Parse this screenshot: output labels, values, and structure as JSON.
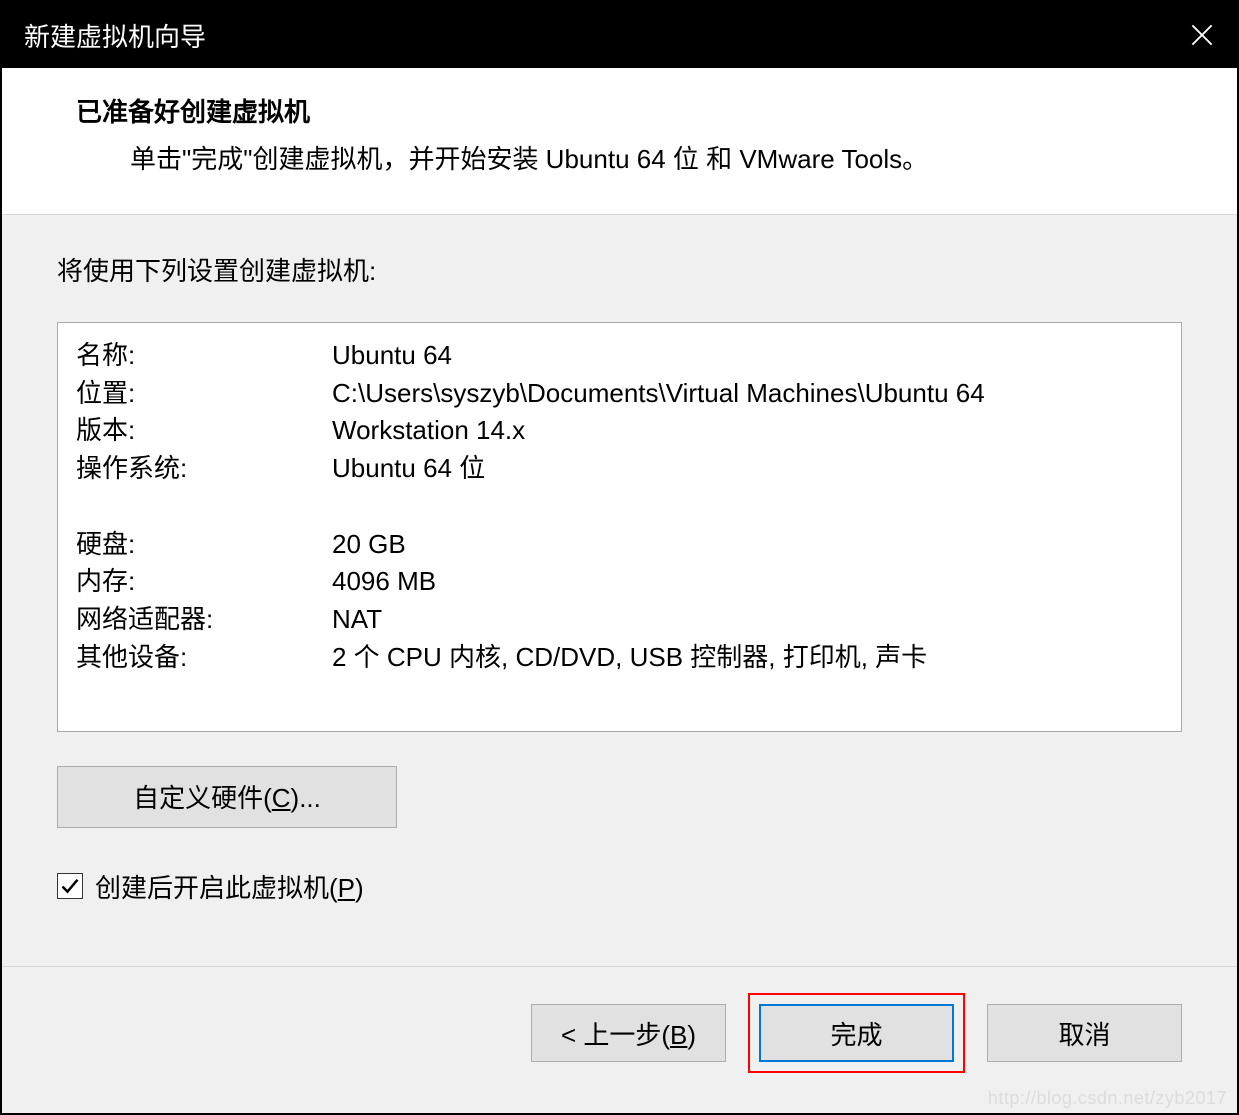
{
  "titlebar": {
    "title": "新建虚拟机向导"
  },
  "header": {
    "title": "已准备好创建虚拟机",
    "subtitle": "单击\"完成\"创建虚拟机，并开始安装 Ubuntu 64 位 和 VMware Tools。"
  },
  "content": {
    "intro": "将使用下列设置创建虚拟机:",
    "rows": [
      {
        "label": "名称:",
        "value": "Ubuntu 64"
      },
      {
        "label": "位置:",
        "value": "C:\\Users\\syszyb\\Documents\\Virtual Machines\\Ubuntu 64"
      },
      {
        "label": "版本:",
        "value": "Workstation 14.x"
      },
      {
        "label": "操作系统:",
        "value": "Ubuntu 64 位"
      },
      {
        "label": "硬盘:",
        "value": "20 GB"
      },
      {
        "label": "内存:",
        "value": "4096 MB"
      },
      {
        "label": "网络适配器:",
        "value": "NAT"
      },
      {
        "label": "其他设备:",
        "value": "2 个 CPU 内核, CD/DVD, USB 控制器, 打印机, 声卡"
      }
    ],
    "custom_hw_prefix": "自定义硬件(",
    "custom_hw_key": "C",
    "custom_hw_suffix": ")...",
    "checkbox_prefix": "创建后开启此虚拟机(",
    "checkbox_key": "P",
    "checkbox_suffix": ")"
  },
  "footer": {
    "back_prefix": "< 上一步(",
    "back_key": "B",
    "back_suffix": ")",
    "finish": "完成",
    "cancel": "取消"
  },
  "watermark": "http://blog.csdn.net/zyb2017"
}
